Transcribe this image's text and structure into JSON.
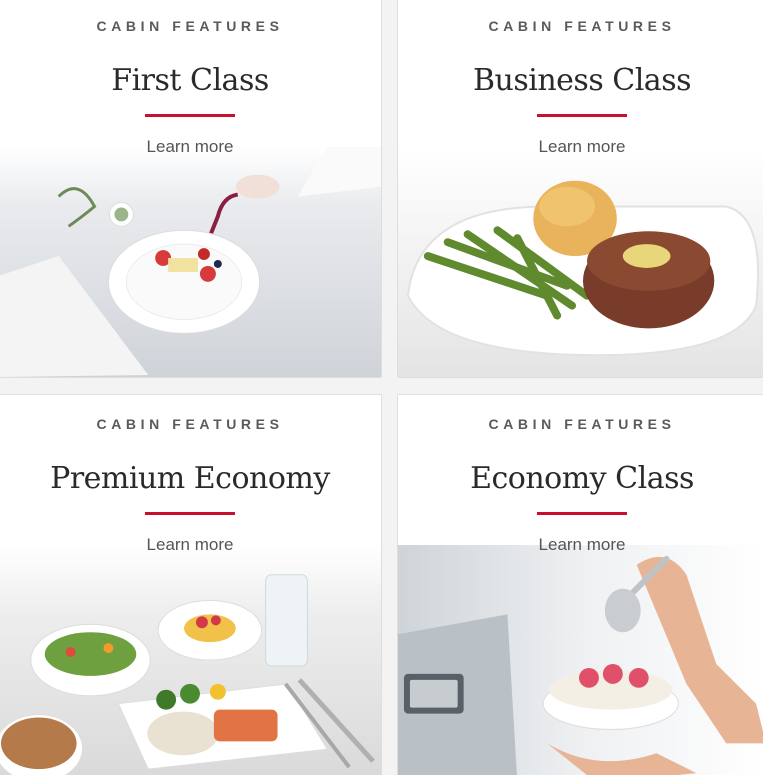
{
  "cards": [
    {
      "eyebrow": "CABIN FEATURES",
      "title": "First Class",
      "link": "Learn more",
      "image": "first-class-dessert-photo"
    },
    {
      "eyebrow": "CABIN FEATURES",
      "title": "Business Class",
      "link": "Learn more",
      "image": "business-class-steak-photo"
    },
    {
      "eyebrow": "CABIN FEATURES",
      "title": "Premium Economy",
      "link": "Learn more",
      "image": "premium-economy-meal-photo"
    },
    {
      "eyebrow": "CABIN FEATURES",
      "title": "Economy Class",
      "link": "Learn more",
      "image": "economy-class-dessert-photo"
    }
  ],
  "colors": {
    "accent": "#c8102e",
    "text": "#2a2a2a",
    "muted": "#555555"
  }
}
